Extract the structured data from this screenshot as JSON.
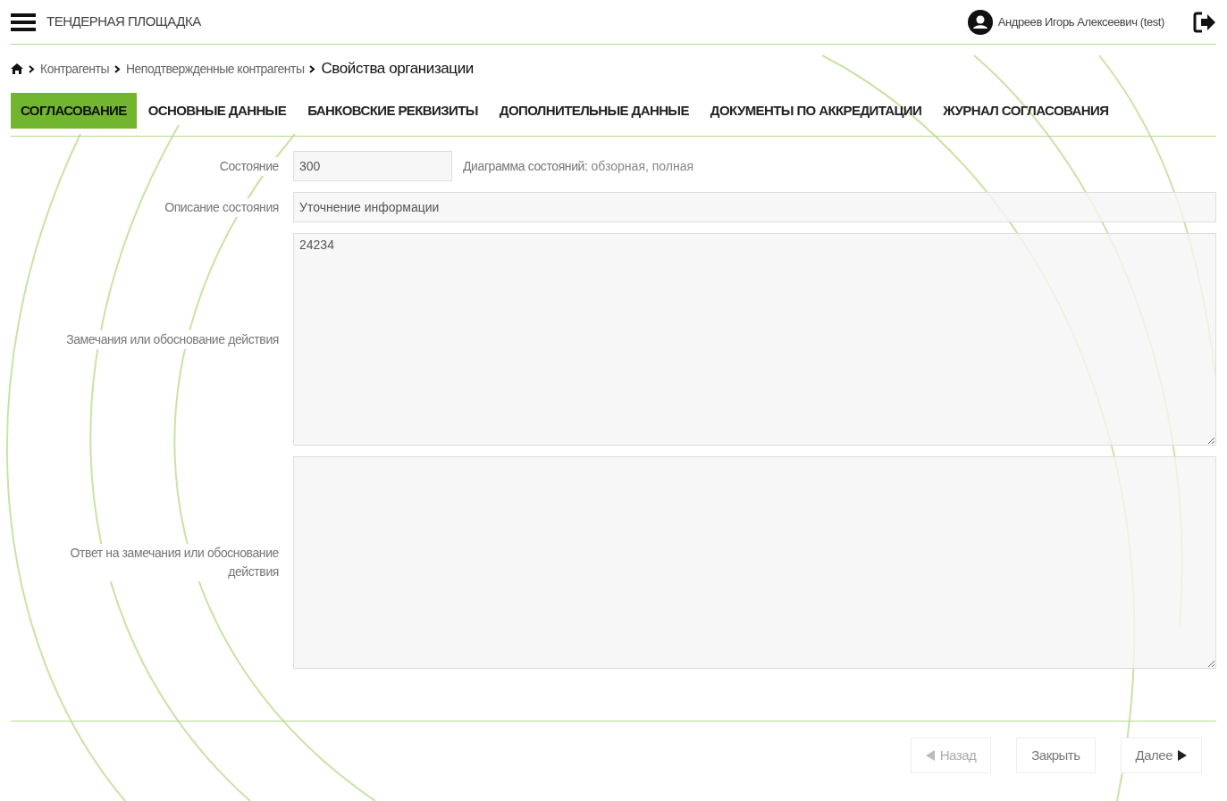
{
  "header": {
    "title": "ТЕНДЕРНАЯ ПЛОЩАДКА",
    "user": "Андреев Игорь Алексеевич (test)"
  },
  "breadcrumbs": [
    "Контрагенты",
    "Неподтвержденные контрагенты",
    "Свойства организации"
  ],
  "tabs": [
    {
      "label": "СОГЛАСОВАНИЕ",
      "selected": true
    },
    {
      "label": "ОСНОВНЫЕ ДАННЫЕ",
      "selected": false
    },
    {
      "label": "БАНКОВСКИЕ РЕКВИЗИТЫ",
      "selected": false
    },
    {
      "label": "ДОПОЛНИТЕЛЬНЫЕ ДАННЫЕ",
      "selected": false
    },
    {
      "label": "ДОКУМЕНТЫ ПО АККРЕДИТАЦИИ",
      "selected": false
    },
    {
      "label": "ЖУРНАЛ СОГЛАСОВАНИЯ",
      "selected": false
    }
  ],
  "form": {
    "state": {
      "label": "Состояние",
      "value": "300"
    },
    "diagram": {
      "label": "Диаграмма состояний:",
      "value": "обзорная, полная"
    },
    "description": {
      "label": "Описание состояния",
      "value": "Уточнение информации"
    },
    "remarks": {
      "label": "Замечания или обоснование действия",
      "value": "24234"
    },
    "answer": {
      "label": "Ответ на замечания или обоснование действия"
    }
  },
  "buttons": [
    {
      "label": "Назад",
      "kind": "back",
      "disabled": true
    },
    {
      "label": "Закрыть",
      "kind": "close",
      "disabled": false
    },
    {
      "label": "Далее",
      "kind": "next",
      "disabled": false
    }
  ]
}
